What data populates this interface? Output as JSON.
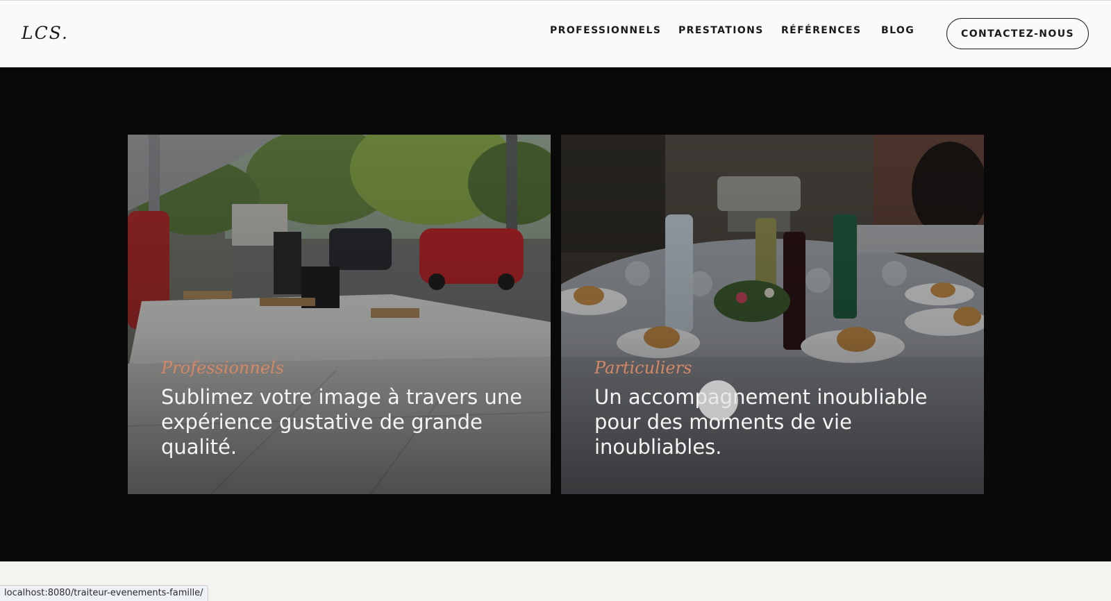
{
  "header": {
    "logo": "LCS.",
    "nav": [
      {
        "label": "PROFESSIONNELS"
      },
      {
        "label": "PRESTATIONS"
      },
      {
        "label": "RÉFÉRENCES"
      },
      {
        "label": "BLOG"
      }
    ],
    "cta_label": "CONTACTEZ-NOUS"
  },
  "cards": [
    {
      "category": "Professionnels",
      "text": "Sublimez votre image à travers une expérience gustative de grande qualité."
    },
    {
      "category": "Particuliers",
      "text": "Un accompagnement inoubliable pour des moments de vie inoubliables."
    }
  ],
  "status_bar": {
    "url": "localhost:8080/traiteur-evenements-famille/"
  },
  "colors": {
    "accent": "#d58866",
    "dark_section": "#0a0909",
    "header_bg": "#fafaf9"
  }
}
